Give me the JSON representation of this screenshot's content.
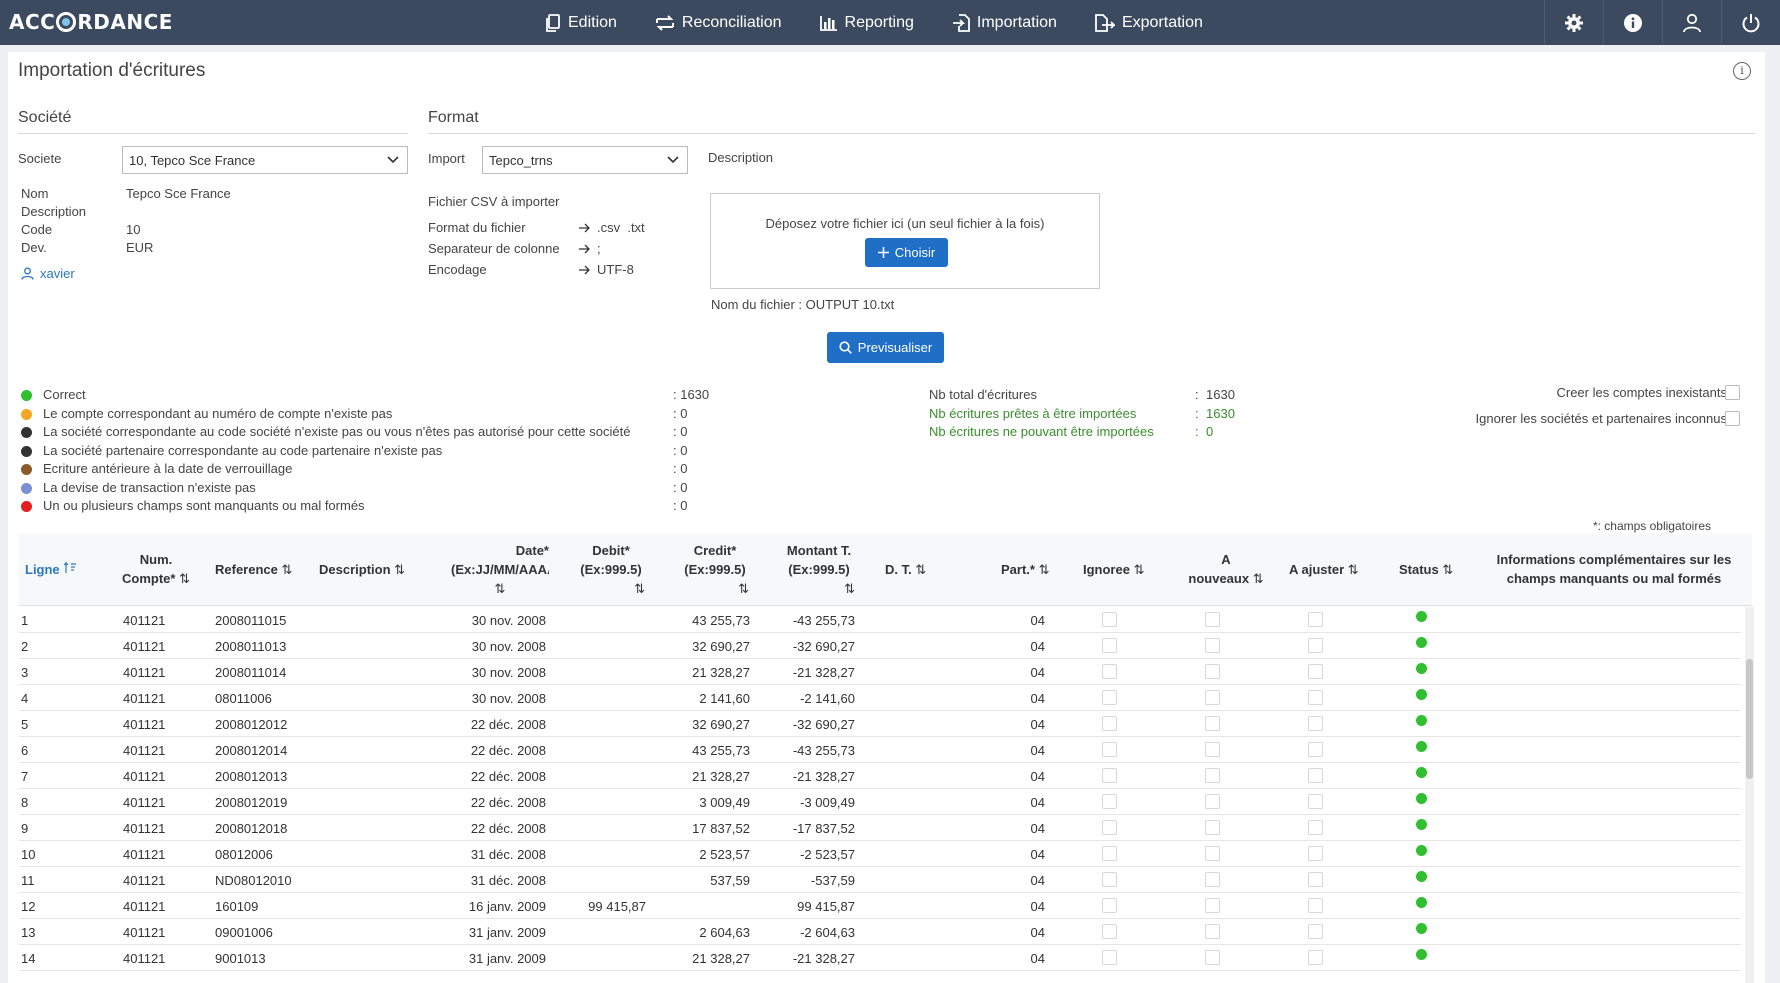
{
  "app": {
    "logo_pre": "ACC",
    "logo_post": "RDANCE"
  },
  "nav": [
    {
      "label": "Edition",
      "icon": "document-copy-icon"
    },
    {
      "label": "Reconciliation",
      "icon": "reconcile-arrows-icon"
    },
    {
      "label": "Reporting",
      "icon": "bar-chart-icon"
    },
    {
      "label": "Importation",
      "icon": "import-file-icon"
    },
    {
      "label": "Exportation",
      "icon": "export-file-icon"
    }
  ],
  "page": {
    "title": "Importation d'écritures"
  },
  "societe": {
    "section_title": "Société",
    "label": "Societe",
    "selected": "10, Tepco Sce France",
    "fields": [
      {
        "label": "Nom",
        "value": "Tepco Sce France"
      },
      {
        "label": "Description",
        "value": ""
      },
      {
        "label": "Code",
        "value": "10"
      },
      {
        "label": "Dev.",
        "value": "EUR"
      }
    ],
    "user": "xavier"
  },
  "format": {
    "section_title": "Format",
    "import_label": "Import",
    "import_selected": "Tepco_trns",
    "description_label": "Description",
    "csv_title": "Fichier CSV à importer",
    "specs": [
      {
        "label": "Format du fichier",
        "value": ".csv  .txt"
      },
      {
        "label": "Separateur de colonne",
        "value": ";"
      },
      {
        "label": "Encodage",
        "value": "UTF-8"
      }
    ],
    "dropzone_text": "Déposez votre fichier ici (un seul fichier à la fois)",
    "choose_label": "Choisir",
    "filename": "Nom du fichier : OUTPUT 10.txt",
    "preview_label": "Previsualiser"
  },
  "legend": [
    {
      "label": "Correct",
      "value": ": 1630",
      "color": "#2fbf2f"
    },
    {
      "label": "Le compte correspondant au numéro de compte n'existe pas",
      "value": ": 0",
      "color": "#f5a623"
    },
    {
      "label": "La société correspondante au code société n'existe pas ou vous n'êtes pas autorisé pour cette société",
      "value": ": 0",
      "color": "#333333"
    },
    {
      "label": "La société partenaire correspondante au code partenaire n'existe pas",
      "value": ": 0",
      "color": "#333333"
    },
    {
      "label": "Ecriture antérieure à la date de verrouillage",
      "value": ": 0",
      "color": "#8b5a2b"
    },
    {
      "label": "La devise de transaction n'existe pas",
      "value": ": 0",
      "color": "#7b8fd6"
    },
    {
      "label": "Un ou plusieurs champs sont manquants ou mal formés",
      "value": ": 0",
      "color": "#e02020"
    }
  ],
  "totals": [
    {
      "label": "Nb total d'écritures",
      "value": "1630",
      "green": false
    },
    {
      "label": "Nb écritures prêtes à être importées",
      "value": "1630",
      "green": true
    },
    {
      "label": "Nb écritures ne pouvant être importées",
      "value": "0",
      "green": true
    }
  ],
  "options": {
    "create_accounts": "Creer les comptes inexistants",
    "ignore_unknown": "Ignorer les sociétés et partenaires inconnus"
  },
  "mandatory_note": "*: champs obligatoires",
  "table": {
    "headers": {
      "ligne": "Ligne",
      "num_compte_1": "Num.",
      "num_compte_2": "Compte*",
      "reference": "Reference",
      "description": "Description",
      "date_1": "Date*",
      "date_2": "(Ex:JJ/MM/AAAA)",
      "debit_1": "Debit*",
      "debit_2": "(Ex:999.5)",
      "credit_1": "Credit*",
      "credit_2": "(Ex:999.5)",
      "montant_1": "Montant T.",
      "montant_2": "(Ex:999.5)",
      "dt": "D. T.",
      "part": "Part.*",
      "ignoree": "Ignoree",
      "anouveaux_1": "A",
      "anouveaux_2": "nouveaux",
      "ajuster": "A ajuster",
      "status": "Status",
      "info_1": "Informations complémentaires sur les",
      "info_2": "champs manquants ou mal formés"
    },
    "rows": [
      {
        "ligne": "1",
        "compte": "401121",
        "ref": "2008011015",
        "date": "30 nov. 2008",
        "debit": "",
        "credit": "43 255,73",
        "montant": "-43 255,73",
        "part": "04"
      },
      {
        "ligne": "2",
        "compte": "401121",
        "ref": "2008011013",
        "date": "30 nov. 2008",
        "debit": "",
        "credit": "32 690,27",
        "montant": "-32 690,27",
        "part": "04"
      },
      {
        "ligne": "3",
        "compte": "401121",
        "ref": "2008011014",
        "date": "30 nov. 2008",
        "debit": "",
        "credit": "21 328,27",
        "montant": "-21 328,27",
        "part": "04"
      },
      {
        "ligne": "4",
        "compte": "401121",
        "ref": "08011006",
        "date": "30 nov. 2008",
        "debit": "",
        "credit": "2 141,60",
        "montant": "-2 141,60",
        "part": "04"
      },
      {
        "ligne": "5",
        "compte": "401121",
        "ref": "2008012012",
        "date": "22 déc. 2008",
        "debit": "",
        "credit": "32 690,27",
        "montant": "-32 690,27",
        "part": "04"
      },
      {
        "ligne": "6",
        "compte": "401121",
        "ref": "2008012014",
        "date": "22 déc. 2008",
        "debit": "",
        "credit": "43 255,73",
        "montant": "-43 255,73",
        "part": "04"
      },
      {
        "ligne": "7",
        "compte": "401121",
        "ref": "2008012013",
        "date": "22 déc. 2008",
        "debit": "",
        "credit": "21 328,27",
        "montant": "-21 328,27",
        "part": "04"
      },
      {
        "ligne": "8",
        "compte": "401121",
        "ref": "2008012019",
        "date": "22 déc. 2008",
        "debit": "",
        "credit": "3 009,49",
        "montant": "-3 009,49",
        "part": "04"
      },
      {
        "ligne": "9",
        "compte": "401121",
        "ref": "2008012018",
        "date": "22 déc. 2008",
        "debit": "",
        "credit": "17 837,52",
        "montant": "-17 837,52",
        "part": "04"
      },
      {
        "ligne": "10",
        "compte": "401121",
        "ref": "08012006",
        "date": "31 déc. 2008",
        "debit": "",
        "credit": "2 523,57",
        "montant": "-2 523,57",
        "part": "04"
      },
      {
        "ligne": "11",
        "compte": "401121",
        "ref": "ND08012010",
        "date": "31 déc. 2008",
        "debit": "",
        "credit": "537,59",
        "montant": "-537,59",
        "part": "04"
      },
      {
        "ligne": "12",
        "compte": "401121",
        "ref": "160109",
        "date": "16 janv. 2009",
        "debit": "99 415,87",
        "credit": "",
        "montant": "99 415,87",
        "part": "04"
      },
      {
        "ligne": "13",
        "compte": "401121",
        "ref": "09001006",
        "date": "31 janv. 2009",
        "debit": "",
        "credit": "2 604,63",
        "montant": "-2 604,63",
        "part": "04"
      },
      {
        "ligne": "14",
        "compte": "401121",
        "ref": "9001013",
        "date": "31 janv. 2009",
        "debit": "",
        "credit": "21 328,27",
        "montant": "-21 328,27",
        "part": "04"
      }
    ]
  }
}
